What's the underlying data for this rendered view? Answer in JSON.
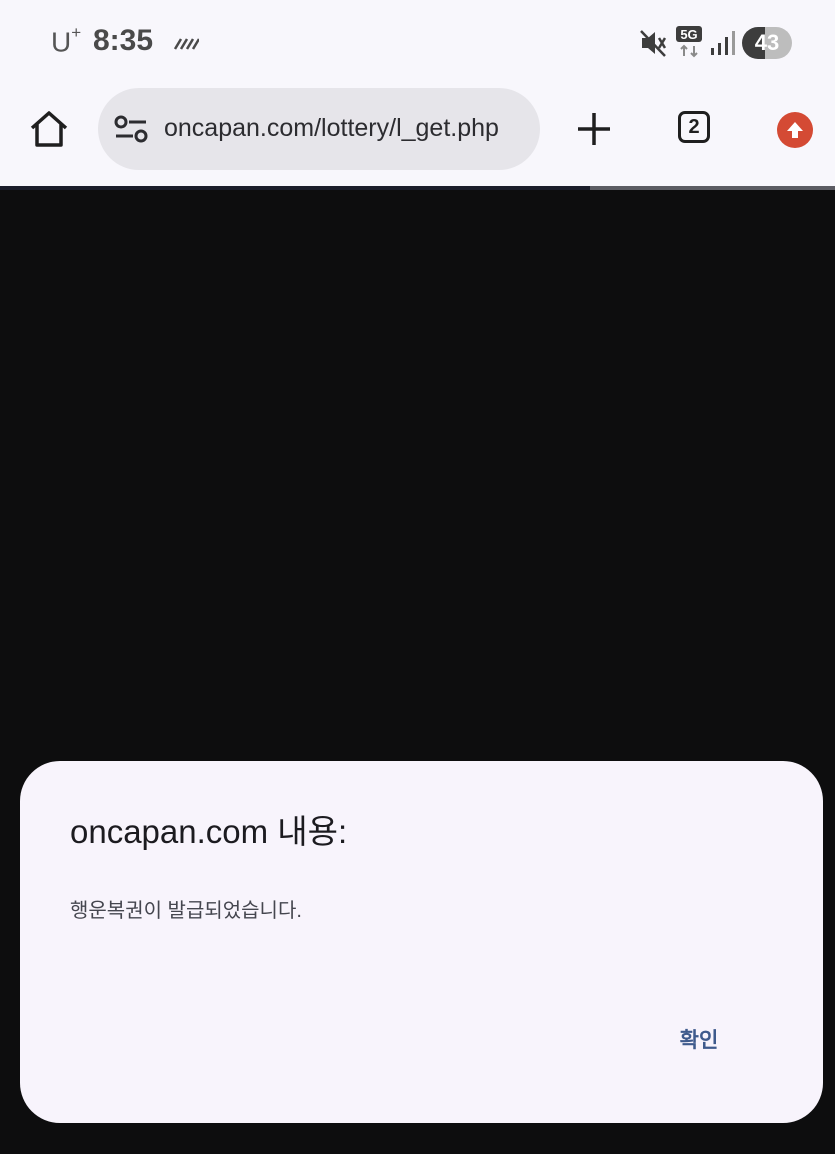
{
  "status_bar": {
    "carrier": "U",
    "carrier_sup": "+",
    "time": "8:35",
    "network": "5G",
    "battery": "43"
  },
  "toolbar": {
    "url": "oncapan.com/lottery/l_get.php",
    "tab_count": "2"
  },
  "dialog": {
    "title": "oncapan.com 내용:",
    "message": "행운복권이 발급되었습니다.",
    "confirm_label": "확인"
  },
  "icons": {
    "home": "home-icon",
    "site_settings": "tune-icon",
    "new_tab": "plus-icon",
    "update": "arrow-up-icon",
    "mute": "mute-icon",
    "signal": "signal-icon",
    "notification": "notification-icon"
  },
  "colors": {
    "chrome_bg": "#f8f7fc",
    "page_bg": "#0d0d0e",
    "dialog_bg": "#f8f4fc",
    "accent": "#3e5a8c",
    "update_badge": "#d44a34"
  }
}
